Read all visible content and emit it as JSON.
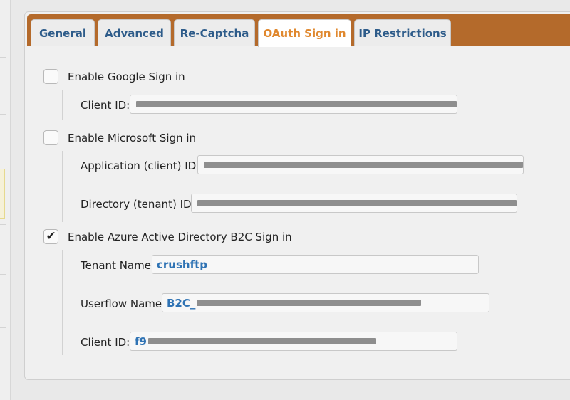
{
  "tabs": [
    {
      "label": "General",
      "active": false
    },
    {
      "label": "Advanced",
      "active": false
    },
    {
      "label": "Re-Captcha",
      "active": false
    },
    {
      "label": "OAuth Sign in",
      "active": true
    },
    {
      "label": "IP Restrictions",
      "active": false
    }
  ],
  "google": {
    "enable_label": "Enable Google Sign in",
    "checked": false,
    "client_id_label": "Client ID:",
    "client_id_value": "[redacted]"
  },
  "microsoft": {
    "enable_label": "Enable Microsoft Sign in",
    "checked": false,
    "app_id_label": "Application (client) ID:",
    "app_id_value": "[redacted]",
    "tenant_id_label": "Directory (tenant) ID:",
    "tenant_id_value": "[redacted]"
  },
  "azure_b2c": {
    "enable_label": "Enable Azure Active Directory B2C Sign in",
    "checked": true,
    "tenant_name_label": "Tenant Name:",
    "tenant_name_value": "crushftp",
    "userflow_label": "Userflow Name:",
    "userflow_prefix": "B2C_",
    "userflow_value_rest": "[redacted]",
    "client_id_label": "Client ID:",
    "client_id_prefix": "f9",
    "client_id_value_rest": "[redacted]"
  },
  "colors": {
    "tab_bar": "#b46a2b",
    "active_tab_text": "#e0882e",
    "tab_text": "#2e5c8a",
    "value_text": "#2f73b4"
  }
}
